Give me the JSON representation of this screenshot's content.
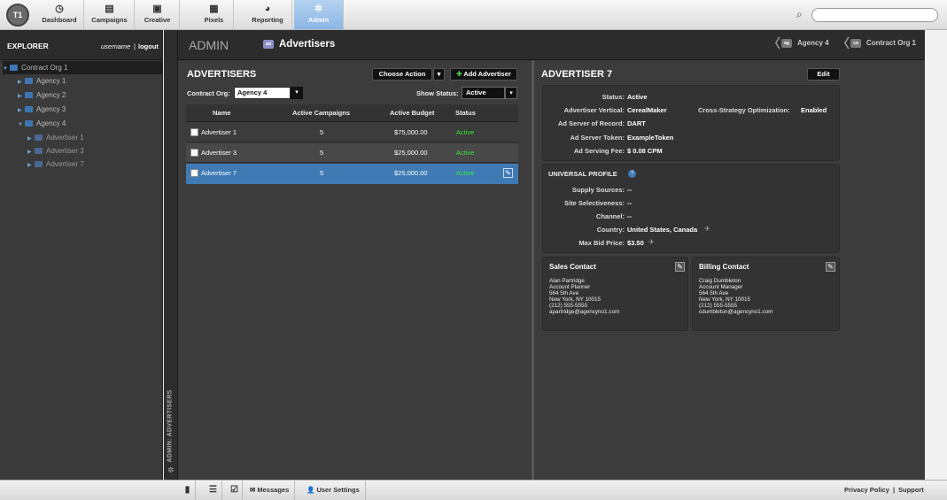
{
  "topnav": {
    "logo": "T1",
    "items": [
      {
        "label": "Dashboard",
        "icon": "dashboard-icon",
        "glyph": "◷"
      },
      {
        "label": "Campaigns",
        "icon": "campaigns-icon",
        "glyph": "▤"
      },
      {
        "label": "Creative",
        "icon": "creative-icon",
        "glyph": "▣"
      },
      {
        "label": "Pixels",
        "icon": "pixels-icon",
        "glyph": "▦"
      },
      {
        "label": "Reporting",
        "icon": "reporting-icon",
        "glyph": "◕"
      },
      {
        "label": "Admin",
        "icon": "admin-gear-icon",
        "glyph": "✲"
      }
    ],
    "active": "Admin",
    "search_placeholder": ""
  },
  "explorer": {
    "title": "EXPLORER",
    "username": "username",
    "separator": "|",
    "logout": "logout",
    "tree": [
      {
        "label": "Contract Org 1",
        "level": 0,
        "expanded": true,
        "type": "org"
      },
      {
        "label": "Agency 1",
        "level": 1,
        "expanded": false,
        "type": "agency"
      },
      {
        "label": "Agency 2",
        "level": 1,
        "expanded": false,
        "type": "agency"
      },
      {
        "label": "Agency 3",
        "level": 1,
        "expanded": false,
        "type": "agency"
      },
      {
        "label": "Agency 4",
        "level": 1,
        "expanded": true,
        "type": "agency"
      },
      {
        "label": "Advertiser 1",
        "level": 2,
        "expanded": false,
        "type": "adv"
      },
      {
        "label": "Advertiser 3",
        "level": 2,
        "expanded": false,
        "type": "adv"
      },
      {
        "label": "Advertiser 7",
        "level": 2,
        "expanded": false,
        "type": "adv"
      }
    ],
    "vertical_label": "ADMIN: ADVERTISERS"
  },
  "breadcrumb": {
    "section": "ADMIN",
    "current": "Advertisers",
    "current_badge": "ad",
    "chips": [
      {
        "badge": "ag",
        "label": "Agency 4"
      },
      {
        "badge": "co",
        "label": "Contract Org 1"
      }
    ]
  },
  "advertisers": {
    "title": "ADVERTISERS",
    "choose_action": "Choose Action",
    "add_button": "Add Advertiser",
    "contract_org_label": "Contract Org:",
    "contract_org_value": "Agency 4",
    "show_status_label": "Show Status:",
    "show_status_value": "Active",
    "columns": [
      "Name",
      "Active Campaigns",
      "Active Budget",
      "Status"
    ],
    "rows": [
      {
        "name": "Advertiser 1",
        "campaigns": "5",
        "budget": "$75,000.00",
        "status": "Active",
        "selected": false
      },
      {
        "name": "Advertiser 3",
        "campaigns": "5",
        "budget": "$25,000.00",
        "status": "Active",
        "selected": false
      },
      {
        "name": "Advertiser 7",
        "campaigns": "5",
        "budget": "$25,000.00",
        "status": "Active",
        "selected": true
      }
    ]
  },
  "detail": {
    "title": "ADVERTISER 7",
    "edit": "Edit",
    "fields": [
      {
        "label": "Status:",
        "value": "Active"
      },
      {
        "label": "Advertiser Vertical:",
        "value": "CerealMaker"
      },
      {
        "label": "Ad Server of Record:",
        "value": "DART"
      },
      {
        "label": "Ad Server Token:",
        "value": "ExampleToken"
      },
      {
        "label": "Ad Serving Fee:",
        "value": "$ 0.08 CPM"
      }
    ],
    "cso_label": "Cross-Strategy Optimization:",
    "cso_value": "Enabled",
    "universal_profile": {
      "title": "UNIVERSAL PROFILE",
      "fields": [
        {
          "label": "Supply Sources:",
          "value": "--"
        },
        {
          "label": "Site Selectiveness:",
          "value": "--"
        },
        {
          "label": "Channel:",
          "value": "--"
        },
        {
          "label": "Country:",
          "value": "United States, Canada"
        },
        {
          "label": "Max Bid Price:",
          "value": "$3.50"
        }
      ]
    },
    "sales_contact": {
      "title": "Sales Contact",
      "lines": [
        "Alan Partridge",
        "Account Planner",
        "564 5th Ave",
        "New York, NY 10015",
        "(212) 555-5555",
        "apartridge@agencyno1.com"
      ]
    },
    "billing_contact": {
      "title": "Billing Contact",
      "lines": [
        "Craig Dumbleton",
        "Account Manager",
        "564 5th Ave",
        "New York, NY 10015",
        "(212) 555-5555",
        "cdumbleton@agencyno1.com"
      ]
    }
  },
  "footer": {
    "messages": "Messages",
    "user_settings": "User Settings",
    "privacy": "Privacy Policy",
    "separator": "|",
    "support": "Support"
  },
  "colors": {
    "active_green": "#39e53a",
    "selected_row": "#3f7ab5",
    "nav_active": "#9cc2ea"
  }
}
